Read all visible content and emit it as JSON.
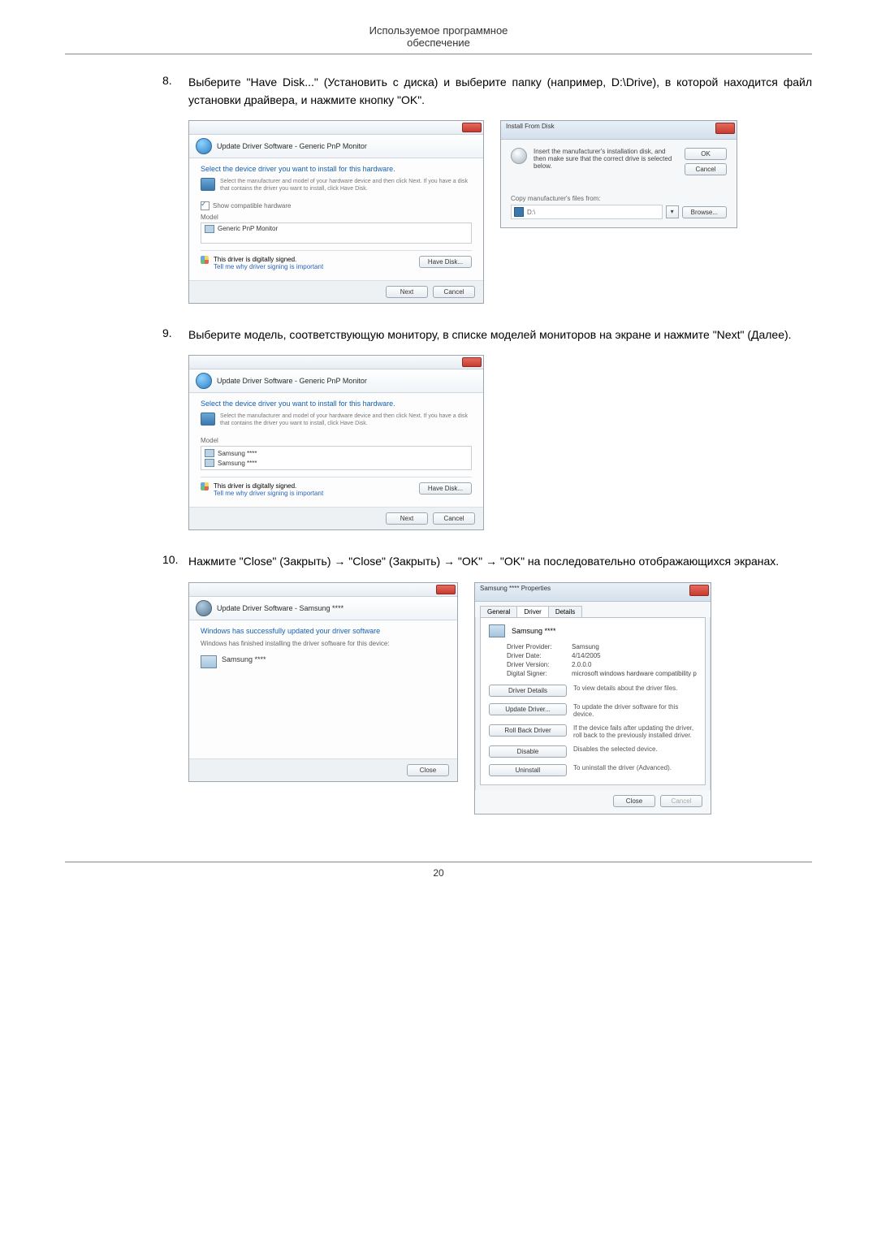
{
  "header": {
    "line1": "Используемое программное",
    "line2": "обеспечение"
  },
  "page_number": "20",
  "steps": [
    {
      "num": "8.",
      "text": "Выберите \"Have Disk...\" (Установить с диска) и выберите папку (например, D:\\Drive), в которой находится файл установки драйвера, и нажмите кнопку \"OK\"."
    },
    {
      "num": "9.",
      "text": "Выберите модель, соответствующую монитору, в списке моделей мониторов на экране и нажмите \"Next\" (Далее)."
    },
    {
      "num": "10.",
      "text": "Нажмите \"Close\" (Закрыть) → \"Close\" (Закрыть) → \"OK\" → \"OK\" на последовательно отображающихся экранах."
    }
  ],
  "dlg_update1": {
    "breadcrumb": "Update Driver Software - Generic PnP Monitor",
    "head": "Select the device driver you want to install for this hardware.",
    "hint": "Select the manufacturer and model of your hardware device and then click Next. If you have a disk that contains the driver you want to install, click Have Disk.",
    "show_compat": "Show compatible hardware",
    "model_lbl": "Model",
    "model_item": "Generic PnP Monitor",
    "signed": "This driver is digitally signed.",
    "tell_me": "Tell me why driver signing is important",
    "have_disk": "Have Disk...",
    "next": "Next",
    "cancel": "Cancel"
  },
  "dlg_ifd": {
    "title": "Install From Disk",
    "insert": "Insert the manufacturer's installation disk, and then make sure that the correct drive is selected below.",
    "ok": "OK",
    "cancel": "Cancel",
    "copy_from": "Copy manufacturer's files from:",
    "path": "D:\\",
    "browse": "Browse..."
  },
  "dlg_update2": {
    "breadcrumb": "Update Driver Software - Generic PnP Monitor",
    "head": "Select the device driver you want to install for this hardware.",
    "hint": "Select the manufacturer and model of your hardware device and then click Next. If you have a disk that contains the driver you want to install, click Have Disk.",
    "model_lbl": "Model",
    "model_item1": "Samsung ****",
    "model_item2": "Samsung ****",
    "signed": "This driver is digitally signed.",
    "tell_me": "Tell me why driver signing is important",
    "have_disk": "Have Disk...",
    "next": "Next",
    "cancel": "Cancel"
  },
  "dlg_done": {
    "breadcrumb": "Update Driver Software - Samsung ****",
    "head": "Windows has successfully updated your driver software",
    "sub": "Windows has finished installing the driver software for this device:",
    "device": "Samsung ****",
    "close": "Close"
  },
  "dlg_props": {
    "title": "Samsung **** Properties",
    "tab_general": "General",
    "tab_driver": "Driver",
    "tab_details": "Details",
    "device": "Samsung ****",
    "provider_k": "Driver Provider:",
    "provider_v": "Samsung",
    "date_k": "Driver Date:",
    "date_v": "4/14/2005",
    "version_k": "Driver Version:",
    "version_v": "2.0.0.0",
    "signer_k": "Digital Signer:",
    "signer_v": "microsoft windows hardware compatibility publisher",
    "btn1": "Driver Details",
    "desc1": "To view details about the driver files.",
    "btn2": "Update Driver...",
    "desc2": "To update the driver software for this device.",
    "btn3": "Roll Back Driver",
    "desc3": "If the device fails after updating the driver, roll back to the previously installed driver.",
    "btn4": "Disable",
    "desc4": "Disables the selected device.",
    "btn5": "Uninstall",
    "desc5": "To uninstall the driver (Advanced).",
    "close": "Close",
    "cancel": "Cancel"
  }
}
